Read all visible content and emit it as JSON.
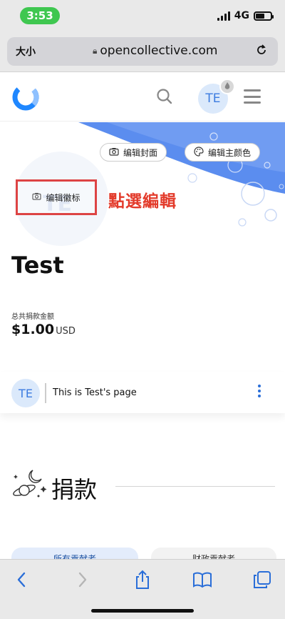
{
  "status_bar": {
    "time": "3:53",
    "network": "4G"
  },
  "browser": {
    "text_size_label": "大小",
    "url": "opencollective.com"
  },
  "header": {
    "avatar_initials": "TE"
  },
  "cover": {
    "edit_cover_label": "编辑封面",
    "edit_color_label": "编辑主颜色",
    "cover_color": "#5b8def"
  },
  "logo_area": {
    "placeholder_initials": "TE",
    "edit_logo_label": "编辑徽标"
  },
  "annotation": {
    "text": "點選編輯",
    "color": "#e33b2b"
  },
  "collective": {
    "name": "Test",
    "raised_label": "总共捐款金额",
    "raised_amount": "$1.00",
    "raised_currency": "USD",
    "avatar_initials": "TE",
    "description": "This is Test's page"
  },
  "section": {
    "title": "捐款"
  },
  "tabs": [
    {
      "label": "所有贡献者"
    },
    {
      "label": "财政贡献者"
    }
  ]
}
